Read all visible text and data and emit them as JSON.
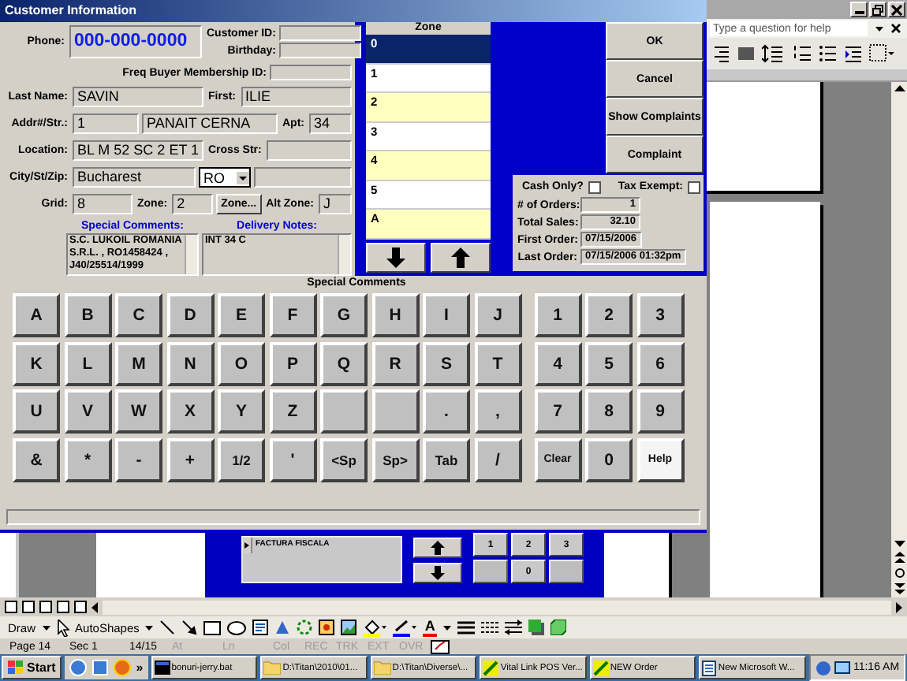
{
  "dialog": {
    "title": "Customer Information",
    "phone": {
      "label": "Phone:",
      "value": "000-000-0000"
    },
    "customer_id": {
      "label": "Customer ID:"
    },
    "birthday": {
      "label": "Birthday:"
    },
    "freq_buyer_id": {
      "label": "Freq Buyer Membership ID:"
    },
    "last_name": {
      "label": "Last Name:",
      "value": "SAVIN"
    },
    "first_name": {
      "label": "First:",
      "value": "ILIE"
    },
    "address": {
      "label": "Addr#/Str.:",
      "number": "1",
      "street": "PANAIT CERNA"
    },
    "apt": {
      "label": "Apt:",
      "value": "34"
    },
    "location": {
      "label": "Location:",
      "value": "BL M 52 SC 2 ET 1"
    },
    "cross_street": {
      "label": "Cross Str:"
    },
    "city": {
      "label": "City/St/Zip:",
      "value": "Bucharest",
      "state": "RO"
    },
    "grid": {
      "label": "Grid:",
      "value": "8"
    },
    "zone": {
      "label": "Zone:",
      "value": "2"
    },
    "zone_button": "Zone...",
    "alt_zone": {
      "label": "Alt Zone:",
      "value": "J"
    },
    "special_comments": {
      "label": "Special Comments:",
      "value": "S.C. LUKOIL ROMANIA\nS.R.L. , RO1458424 ,\nJ40/25514/1999"
    },
    "delivery_notes": {
      "label": "Delivery Notes:",
      "value": "INT 34 C"
    },
    "zone_list": {
      "header": "Zone",
      "items": [
        {
          "label": "0",
          "selected": true
        },
        {
          "label": "1",
          "selected": false
        },
        {
          "label": "2",
          "selected": false
        },
        {
          "label": "3",
          "selected": false
        },
        {
          "label": "4",
          "selected": false
        },
        {
          "label": "5",
          "selected": false
        },
        {
          "label": "A",
          "selected": false
        }
      ]
    },
    "buttons": [
      "OK",
      "Cancel",
      "Show Complaints",
      "Complaint"
    ],
    "cash_only": {
      "label": "Cash Only?",
      "checked": false
    },
    "tax_exempt": {
      "label": "Tax Exempt:",
      "checked": false
    },
    "stats": [
      {
        "label": "# of Orders:",
        "value": "1"
      },
      {
        "label": "Total Sales:",
        "value": "32.10"
      },
      {
        "label": "First Order:",
        "value": "07/15/2006"
      },
      {
        "label": "Last Order:",
        "value": "07/15/2006 01:32pm"
      }
    ],
    "keyboard": {
      "title": "Special Comments",
      "letter_keys": [
        {
          "label": "A",
          "kind": "key"
        },
        {
          "label": "B",
          "kind": "key"
        },
        {
          "label": "C",
          "kind": "key"
        },
        {
          "label": "D",
          "kind": "key"
        },
        {
          "label": "E",
          "kind": "key"
        },
        {
          "label": "F",
          "kind": "key"
        },
        {
          "label": "G",
          "kind": "key"
        },
        {
          "label": "H",
          "kind": "key"
        },
        {
          "label": "I",
          "kind": "key"
        },
        {
          "label": "J",
          "kind": "key"
        },
        {
          "label": "K",
          "kind": "key"
        },
        {
          "label": "L",
          "kind": "key"
        },
        {
          "label": "M",
          "kind": "key"
        },
        {
          "label": "N",
          "kind": "key"
        },
        {
          "label": "O",
          "kind": "key"
        },
        {
          "label": "P",
          "kind": "key"
        },
        {
          "label": "Q",
          "kind": "key"
        },
        {
          "label": "R",
          "kind": "key"
        },
        {
          "label": "S",
          "kind": "key"
        },
        {
          "label": "T",
          "kind": "key"
        },
        {
          "label": "U",
          "kind": "key"
        },
        {
          "label": "V",
          "kind": "key"
        },
        {
          "label": "W",
          "kind": "key"
        },
        {
          "label": "X",
          "kind": "key"
        },
        {
          "label": "Y",
          "kind": "key"
        },
        {
          "label": "Z",
          "kind": "key"
        },
        {
          "kind": "blank"
        },
        {
          "kind": "blank"
        },
        {
          "label": ".",
          "kind": "key"
        },
        {
          "label": ",",
          "kind": "key"
        },
        {
          "label": "&",
          "kind": "key"
        },
        {
          "label": "*",
          "kind": "key"
        },
        {
          "label": "-",
          "kind": "key"
        },
        {
          "label": "+",
          "kind": "key"
        },
        {
          "label": "1/2",
          "kind": "key"
        },
        {
          "label": "'",
          "kind": "key"
        },
        {
          "label": "<Sp",
          "kind": "key"
        },
        {
          "label": "Sp>",
          "kind": "key"
        },
        {
          "label": "Tab",
          "kind": "key"
        },
        {
          "label": "/",
          "kind": "key"
        }
      ],
      "number_keys": [
        {
          "label": "1",
          "kind": "key"
        },
        {
          "label": "2",
          "kind": "key"
        },
        {
          "label": "3",
          "kind": "key"
        },
        {
          "label": "4",
          "kind": "key"
        },
        {
          "label": "5",
          "kind": "key"
        },
        {
          "label": "6",
          "kind": "key"
        },
        {
          "label": "7",
          "kind": "key"
        },
        {
          "label": "8",
          "kind": "key"
        },
        {
          "label": "9",
          "kind": "key"
        },
        {
          "label": "Clear",
          "kind": "key"
        },
        {
          "label": "0",
          "kind": "key"
        },
        {
          "label": "Help",
          "kind": "focused"
        }
      ]
    }
  },
  "word": {
    "help_box": {
      "placeholder": "Type a question for help"
    },
    "embedded_pos": {
      "list_item": "FACTURA FISCALA",
      "keypad": [
        {
          "label": "1",
          "kind": "key"
        },
        {
          "label": "2",
          "kind": "key"
        },
        {
          "label": "3",
          "kind": "key"
        },
        {
          "kind": "blank"
        },
        {
          "label": "0",
          "kind": "key"
        },
        {
          "kind": "blank"
        }
      ]
    },
    "draw_menu": "Draw",
    "autoshapes_menu": "AutoShapes",
    "font_color_glyph": "A",
    "status": [
      {
        "text": "Page 14",
        "dimmed": false
      },
      {
        "text": "Sec 1",
        "dimmed": false
      },
      {
        "text": "14/15",
        "dimmed": false
      },
      {
        "text": "At",
        "dimmed": true
      },
      {
        "text": "Ln",
        "dimmed": true
      },
      {
        "text": "Col",
        "dimmed": true
      },
      {
        "text": "REC",
        "dimmed": true
      },
      {
        "text": "TRK",
        "dimmed": true
      },
      {
        "text": "EXT",
        "dimmed": true
      },
      {
        "text": "OVR",
        "dimmed": true
      }
    ]
  },
  "taskbar": {
    "start": "Start",
    "more": "»",
    "tasks": [
      {
        "label": "bonuri-jerry.bat",
        "kind": "console"
      },
      {
        "label": "D:\\Titan\\2010\\01...",
        "kind": "folder"
      },
      {
        "label": "D:\\Titan\\Diverse\\...",
        "kind": "folder"
      },
      {
        "label": "Vital Link POS Ver...",
        "kind": "app"
      },
      {
        "label": "NEW Order",
        "kind": "app"
      },
      {
        "label": "New Microsoft W...",
        "kind": "document"
      }
    ],
    "clock": "11:16 AM"
  }
}
